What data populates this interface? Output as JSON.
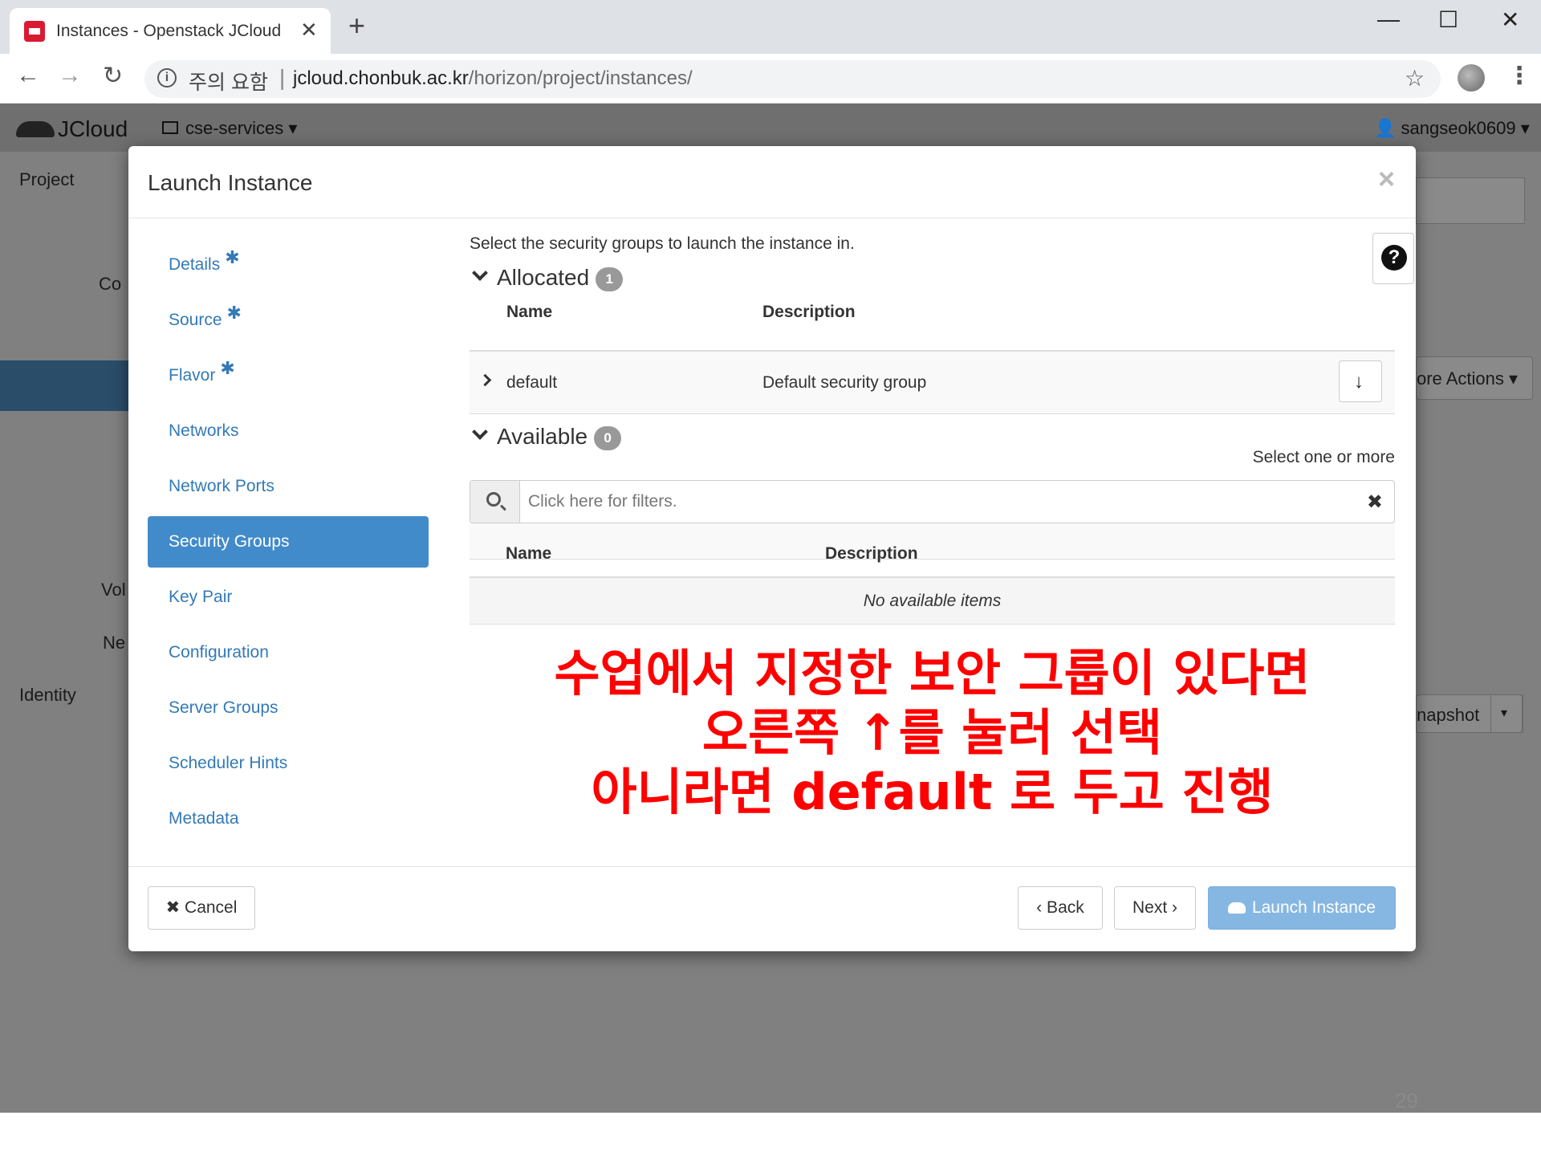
{
  "browser": {
    "tab_title": "Instances - Openstack JCloud",
    "tab_close": "✕",
    "new_tab": "+",
    "minimize": "—",
    "maximize": "☐",
    "close": "✕",
    "back": "←",
    "forward": "→",
    "reload": "↻",
    "security_warning": "주의 요함",
    "url_host": "jcloud.chonbuk.ac.kr",
    "url_path": "/horizon/project/instances/",
    "bookmark": "☆",
    "menu": "⋮"
  },
  "app": {
    "logo": "JCloud",
    "project_selector": "cse-services ▾",
    "user_menu": "👤 sangseok0609 ▾",
    "sidebar_project": "Project",
    "sidebar_identity": "Identity",
    "bg_com": "Co",
    "bg_vol": "Vol",
    "bg_net": "Ne",
    "bg_more_actions": "ore Actions ▾",
    "bg_snapshot": "napshot",
    "bg_snapshot_caret": "▾",
    "slide_number": "29"
  },
  "modal": {
    "title": "Launch Instance",
    "close": "×",
    "nav": [
      {
        "label": "Details",
        "required": "✱"
      },
      {
        "label": "Source",
        "required": "✱"
      },
      {
        "label": "Flavor",
        "required": "✱"
      },
      {
        "label": "Networks"
      },
      {
        "label": "Network Ports"
      },
      {
        "label": "Security Groups"
      },
      {
        "label": "Key Pair"
      },
      {
        "label": "Configuration"
      },
      {
        "label": "Server Groups"
      },
      {
        "label": "Scheduler Hints"
      },
      {
        "label": "Metadata"
      }
    ],
    "help": "?",
    "intro": "Select the security groups to launch the instance in.",
    "allocated": {
      "title": "Allocated",
      "count": "1",
      "col_name": "Name",
      "col_description": "Description",
      "rows": [
        {
          "name": "default",
          "description": "Default security group"
        }
      ]
    },
    "available": {
      "title": "Available",
      "count": "0",
      "hint": "Select one or more",
      "filter_placeholder": "Click here for filters.",
      "filter_clear": "✖",
      "col_name": "Name",
      "col_description": "Description",
      "empty": "No available items"
    },
    "annotation": [
      "수업에서 지정한 보안 그룹이 있다면",
      "오른쪽 ↑를 눌러 선택",
      "아니라면 default 로 두고 진행"
    ],
    "footer": {
      "cancel": "✖ Cancel",
      "back": "‹ Back",
      "next": "Next ›",
      "launch": "Launch Instance"
    }
  }
}
